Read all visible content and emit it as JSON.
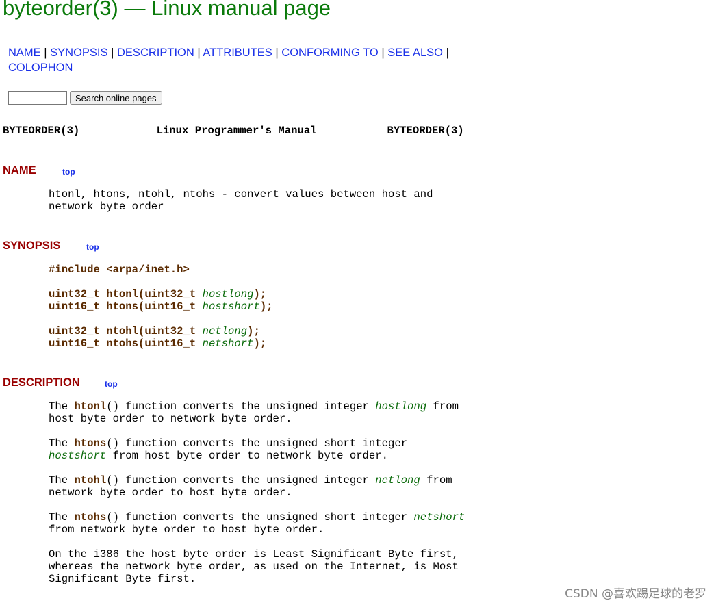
{
  "title": "byteorder(3) — Linux manual page",
  "nav": {
    "links": [
      "NAME",
      "SYNOPSIS",
      "DESCRIPTION",
      "ATTRIBUTES",
      "CONFORMING TO",
      "SEE ALSO",
      "COLOPHON"
    ],
    "separator": "|"
  },
  "search": {
    "input_value": "",
    "button_label": "Search online pages"
  },
  "man_header": {
    "left": "BYTEORDER(3)",
    "center": "Linux Programmer's Manual",
    "right": "BYTEORDER(3)"
  },
  "sections": {
    "name": {
      "heading": "NAME",
      "top_label": "top",
      "lines": [
        "htonl, htons, ntohl, ntohs - convert values between host and",
        "network byte order"
      ]
    },
    "synopsis": {
      "heading": "SYNOPSIS",
      "top_label": "top",
      "include": "#include <arpa/inet.h>",
      "prototypes": [
        {
          "pre": "uint32_t htonl(uint32_t ",
          "param": "hostlong",
          "post": ");"
        },
        {
          "pre": "uint16_t htons(uint16_t ",
          "param": "hostshort",
          "post": ");"
        },
        {
          "pre": "uint32_t ntohl(uint32_t ",
          "param": "netlong",
          "post": ");"
        },
        {
          "pre": "uint16_t ntohs(uint16_t ",
          "param": "netshort",
          "post": ");"
        }
      ]
    },
    "description": {
      "heading": "DESCRIPTION",
      "top_label": "top",
      "p1": {
        "a": "The ",
        "fn": "htonl",
        "b": "() function converts the unsigned integer ",
        "param": "hostlong",
        "c": " from",
        "line2": "host byte order to network byte order."
      },
      "p2": {
        "a": "The ",
        "fn": "htons",
        "b": "() function converts the unsigned short integer",
        "param": "hostshort",
        "line2": " from host byte order to network byte order."
      },
      "p3": {
        "a": "The ",
        "fn": "ntohl",
        "b": "() function converts the unsigned integer ",
        "param": "netlong",
        "c": " from",
        "line2": "network byte order to host byte order."
      },
      "p4": {
        "a": "The ",
        "fn": "ntohs",
        "b": "() function converts the unsigned short integer ",
        "param": "netshort",
        "line2": "from network byte order to host byte order."
      },
      "p5": [
        "On the i386 the host byte order is Least Significant Byte first,",
        "whereas the network byte order, as used on the Internet, is Most",
        "Significant Byte first."
      ]
    }
  },
  "watermark": "CSDN @喜欢踢足球的老罗"
}
